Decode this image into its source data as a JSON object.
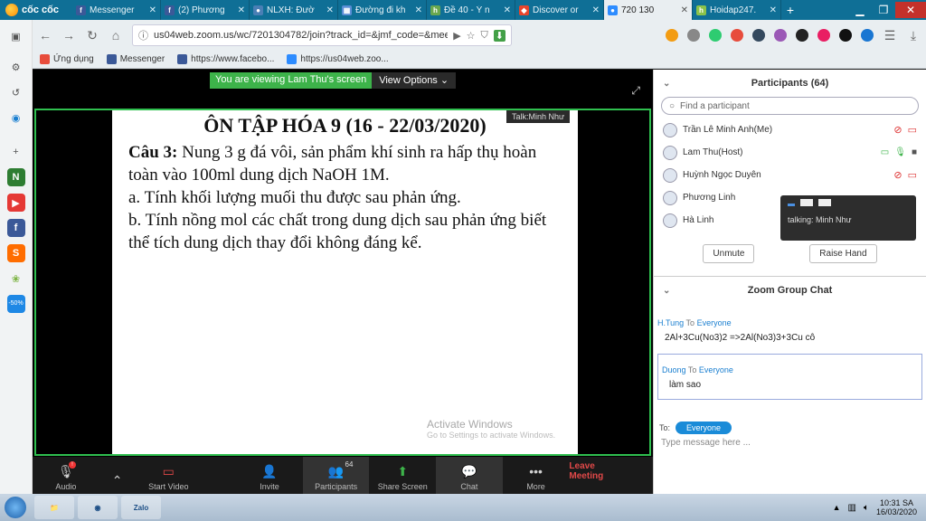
{
  "browser": {
    "brand": "cốc cốc",
    "tabs": [
      {
        "title": "Messenger",
        "color": "#3b5998",
        "glyph": "f"
      },
      {
        "title": "(2) Phương",
        "color": "#3b5998",
        "glyph": "f"
      },
      {
        "title": "NLXH: Đườ",
        "color": "#4a7fb5",
        "glyph": "●"
      },
      {
        "title": "Đường đi kh",
        "color": "#5b8ed6",
        "glyph": "▦"
      },
      {
        "title": "Đề 40 - Ý n",
        "color": "#6aa84f",
        "glyph": "h"
      },
      {
        "title": "Discover or",
        "color": "#e8452c",
        "glyph": "◆"
      },
      {
        "title": "720 130",
        "color": "#2d8cff",
        "glyph": "●",
        "active": true
      },
      {
        "title": "Hoidap247.",
        "color": "#8bc34a",
        "glyph": "h"
      }
    ],
    "url": "us04web.zoom.us/wc/7201304782/join?track_id=&jmf_code=&meeti...",
    "bookmarks": [
      {
        "label": "Ứng dụng",
        "color": "#e74c3c"
      },
      {
        "label": "Messenger",
        "color": "#3b5998"
      },
      {
        "label": "https://www.facebo...",
        "color": "#3b5998"
      },
      {
        "label": "https://us04web.zoo...",
        "color": "#2d8cff"
      }
    ]
  },
  "zoom": {
    "share_banner": "You are viewing Lam Thu's screen",
    "view_options": "View Options",
    "talking_tag": "Talk:Minh Như",
    "slide": {
      "title": "ÔN TẬP HÓA 9 (16 - 22/03/2020)",
      "question_label": "Câu 3:",
      "question_text": " Nung 3 g đá vôi, sản phẩm khí sinh ra hấp thụ hoàn toàn vào 100ml dung dịch NaOH 1M.",
      "part_a": "a. Tính khối lượng muối thu được sau phản ứng.",
      "part_b": "b. Tính nồng mol các chất trong dung dịch sau phản ứng biết thể tích dung dịch thay đổi không đáng kể."
    },
    "watermark_title": "Activate Windows",
    "watermark_sub": "Go to Settings to activate Windows.",
    "toolbar": {
      "audio": "Audio",
      "start_video": "Start Video",
      "invite": "Invite",
      "participants": "Participants",
      "participants_count": "64",
      "share_screen": "Share Screen",
      "chat": "Chat",
      "more": "More",
      "leave": "Leave Meeting"
    }
  },
  "participants_panel": {
    "header": "Participants (64)",
    "search_placeholder": "Find a participant",
    "list": [
      {
        "name": "Trần Lê Minh Anh(Me)"
      },
      {
        "name": "Lam Thu(Host)"
      },
      {
        "name": "Huỳnh Ngọc Duyên"
      },
      {
        "name": "Phương Linh"
      },
      {
        "name": "Hà Linh"
      }
    ],
    "tooltip_talking": "talking: Minh Như",
    "unmute": "Unmute",
    "raise_hand": "Raise Hand"
  },
  "chat_panel": {
    "header": "Zoom Group Chat",
    "messages": [
      {
        "from": "H.Tung",
        "to": "Everyone",
        "text": "2Al+3Cu(No3)2 =>2Al(No3)3+3Cu cô"
      },
      {
        "from": "Duong",
        "to": "Everyone",
        "text": "làm sao"
      }
    ],
    "to_label": "To:",
    "to_target": "Everyone",
    "input_placeholder": "Type message here ..."
  },
  "taskbar": {
    "zalo": "Zalo",
    "time": "10:31 SA",
    "date": "16/03/2020"
  }
}
